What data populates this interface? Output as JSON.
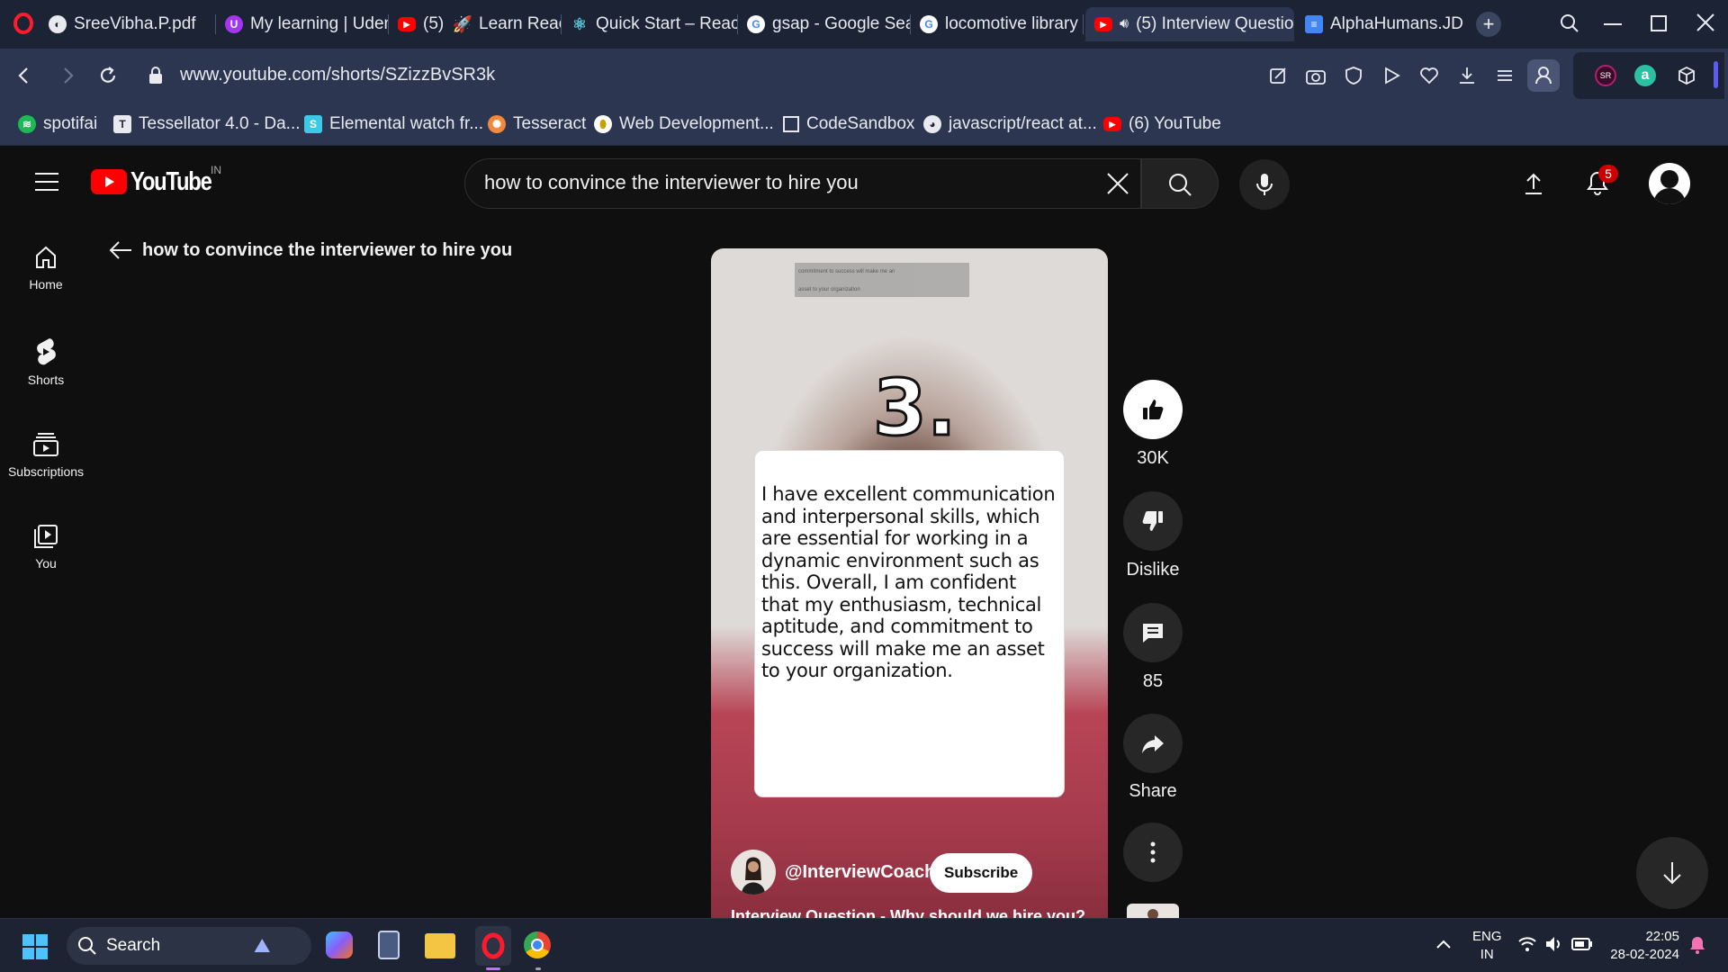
{
  "browser": {
    "tabs": [
      {
        "label": "SreeVibha.P.pdf",
        "icon": "pdf-icon"
      },
      {
        "label": "My learning | Uden",
        "icon": "udemy-icon"
      },
      {
        "label": "(5)",
        "icon": "youtube-icon"
      },
      {
        "label": "Learn React",
        "icon": "rocket-icon"
      },
      {
        "label": "Quick Start – React",
        "icon": "react-icon"
      },
      {
        "label": "gsap - Google Sear",
        "icon": "google-icon"
      },
      {
        "label": "locomotive library",
        "icon": "google-icon"
      },
      {
        "label": "(5) Interview Questio",
        "icon": "youtube-icon",
        "active": true
      },
      {
        "label": "AlphaHumans.JD -",
        "icon": "docs-icon"
      }
    ],
    "url": "www.youtube.com/shorts/SZizzBvSR3k",
    "bookmarks": [
      {
        "label": "spotifai",
        "icon": "spotify-icon"
      },
      {
        "label": "Tessellator 4.0 - Da...",
        "icon": "tessellator-icon"
      },
      {
        "label": "Elemental watch fr...",
        "icon": "elemental-icon"
      },
      {
        "label": "Tesseract",
        "icon": "tesseract-icon"
      },
      {
        "label": "Web Development...",
        "icon": "webdev-icon"
      },
      {
        "label": "CodeSandbox",
        "icon": "codesandbox-icon"
      },
      {
        "label": "javascript/react at...",
        "icon": "github-icon"
      },
      {
        "label": "(6) YouTube",
        "icon": "youtube-icon"
      }
    ],
    "profile_badge": "SR"
  },
  "youtube": {
    "logo_text": "YouTube",
    "region": "IN",
    "search_query": "how to convince the interviewer to hire you",
    "notification_count": "5",
    "sidebar": [
      {
        "label": "Home",
        "icon": "home-icon"
      },
      {
        "label": "Shorts",
        "icon": "shorts-icon"
      },
      {
        "label": "Subscriptions",
        "icon": "subscriptions-icon"
      },
      {
        "label": "You",
        "icon": "you-icon"
      }
    ],
    "back_title": "how to convince the interviewer to hire you",
    "short": {
      "number_overlay": "3.",
      "mini_caption_line1": "commitment to success will make me an",
      "mini_caption_line2": "asset to your organization",
      "caption": "I have excellent communication and interpersonal skills, which are essential for working in a dynamic environment such as this. Overall, I am confident that my enthusiasm, technical aptitude, and commitment to success will make me an asset to your organization.",
      "channel": "@InterviewCoach",
      "subscribe_label": "Subscribe",
      "title": "Interview Question - Why should we hire you?"
    },
    "actions": {
      "likes": "30K",
      "dislike_label": "Dislike",
      "comments": "85",
      "share_label": "Share"
    }
  },
  "taskbar": {
    "search_label": "Search",
    "lang_line1": "ENG",
    "lang_line2": "IN",
    "time": "22:05",
    "date": "28-02-2024"
  },
  "colors": {
    "yt_red": "#ff0000",
    "browser_bg": "#1b2334",
    "page_bg": "#0f0f0f",
    "notification_badge": "#cc0000"
  }
}
